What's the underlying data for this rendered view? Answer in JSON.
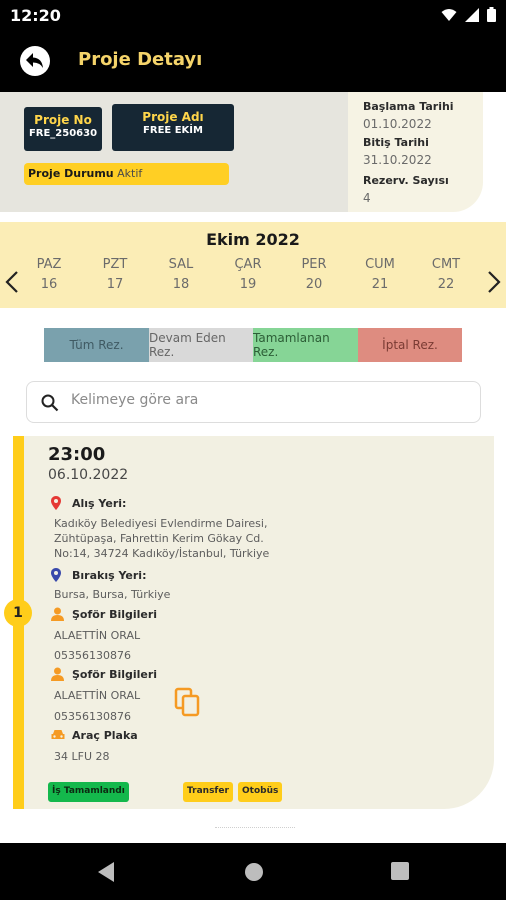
{
  "status_bar": {
    "time": "12:20"
  },
  "app_bar": {
    "title": "Proje Detayı"
  },
  "project": {
    "no_label": "Proje No",
    "no_value": "FRE_250630",
    "name_label": "Proje Adı",
    "name_value": "FREE EKİM",
    "status_key": "Proje Durumu",
    "status_value": "Aktif",
    "start_label": "Başlama Tarihi",
    "start_value": "01.10.2022",
    "end_label": "Bitiş Tarihi",
    "end_value": "31.10.2022",
    "rez_label": "Rezerv. Sayısı",
    "rez_value": "4"
  },
  "calendar": {
    "month": "Ekim 2022",
    "days": [
      {
        "name": "PAZ",
        "num": "16"
      },
      {
        "name": "PZT",
        "num": "17"
      },
      {
        "name": "SAL",
        "num": "18"
      },
      {
        "name": "ÇAR",
        "num": "19"
      },
      {
        "name": "PER",
        "num": "20"
      },
      {
        "name": "CUM",
        "num": "21"
      },
      {
        "name": "CMT",
        "num": "22"
      }
    ]
  },
  "filters": [
    {
      "label": "Tüm Rez.",
      "color": "#7aa1ad"
    },
    {
      "label": "Devam Eden Rez.",
      "color": "#d9d9d9"
    },
    {
      "label": "Tamamlanan Rez.",
      "color": "#86d596"
    },
    {
      "label": "İptal Rez.",
      "color": "#de8c80"
    }
  ],
  "search": {
    "placeholder": "Kelimeye göre ara"
  },
  "reservation": {
    "index": "1",
    "time": "23:00",
    "date": "06.10.2022",
    "pickup_label": "Alış Yeri:",
    "pickup_line1": "Kadıköy Belediyesi Evlendirme Dairesi,",
    "pickup_line2": "Zühtüpaşa, Fahrettin Kerim Gökay Cd.",
    "pickup_line3": "No:14, 34724 Kadıköy/İstanbul, Türkiye",
    "dropoff_label": "Bırakış Yeri:",
    "dropoff_value": "Bursa, Bursa, Türkiye",
    "driver1_label": "Şoför Bilgileri",
    "driver1_name": "ALAETTİN ORAL",
    "driver1_phone": "05356130876",
    "driver2_label": "Şoför Bilgileri",
    "driver2_name": "ALAETTİN ORAL",
    "driver2_phone": "05356130876",
    "plate_label": "Araç Plaka",
    "plate_value": "34 LFU 28",
    "tag_status": "İş Tamamlandı",
    "tag_type": "Transfer",
    "tag_vehicle": "Otobüs"
  },
  "colors": {
    "accent": "#ffcd1a",
    "title_yellow": "#f5d46a",
    "dark_box": "#162734",
    "calendar_bg": "#fbedb6",
    "card_bg": "#f2f0e2",
    "pin_red": "#e53935",
    "pin_blue": "#3949ab",
    "person_orange": "#f59a23"
  }
}
